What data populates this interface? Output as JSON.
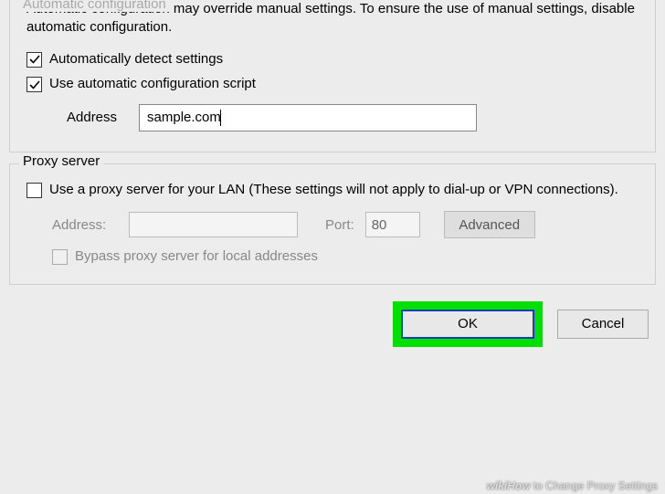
{
  "auto_config": {
    "legend": "Automatic configuration",
    "description": "Automatic configuration may override manual settings.  To ensure the use of manual settings, disable automatic configuration.",
    "detect_label": "Automatically detect settings",
    "detect_checked": true,
    "script_label": "Use automatic configuration script",
    "script_checked": true,
    "address_label": "Address",
    "address_value": "sample.com"
  },
  "proxy": {
    "legend": "Proxy server",
    "use_label": "Use a proxy server for your LAN (These settings will not apply to dial-up or VPN connections).",
    "use_checked": false,
    "address_label": "Address:",
    "address_value": "",
    "port_label": "Port:",
    "port_value": "80",
    "advanced_label": "Advanced",
    "bypass_label": "Bypass proxy server for local addresses",
    "bypass_checked": false
  },
  "footer": {
    "ok_label": "OK",
    "cancel_label": "Cancel"
  },
  "watermark": {
    "brand": "wikiHow",
    "title": " to Change Proxy Settings"
  }
}
